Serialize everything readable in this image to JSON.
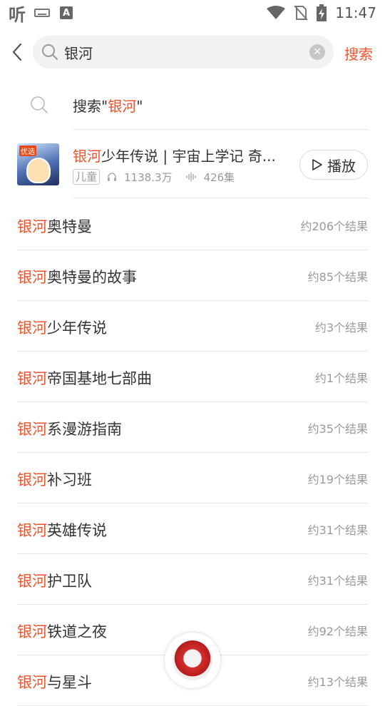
{
  "status_bar": {
    "app_logo": "听",
    "time": "11:47",
    "icons": [
      "keyboard-icon",
      "a-icon",
      "wifi-icon",
      "no-sim-icon",
      "battery-charging-icon"
    ],
    "a_label": "A"
  },
  "search": {
    "query": "银河",
    "placeholder": "",
    "submit_label": "搜索",
    "clear_icon": "✕"
  },
  "suggest": {
    "prefix": "搜索\"",
    "keyword": "银河",
    "suffix": "\""
  },
  "album": {
    "cover_tag": "优选",
    "title_highlight": "银河",
    "title_rest": "少年传说 | 宇宙上学记 奇...",
    "category": "儿童",
    "plays": "1138.3万",
    "episodes": "426集",
    "play_label": "播放"
  },
  "highlight_color": "#f0532c",
  "results": [
    {
      "highlight": "银河",
      "rest": "奥特曼",
      "count": "约206个结果"
    },
    {
      "highlight": "银河",
      "rest": "奥特曼的故事",
      "count": "约85个结果"
    },
    {
      "highlight": "银河",
      "rest": "少年传说",
      "count": "约3个结果"
    },
    {
      "highlight": "银河",
      "rest": "帝国基地七部曲",
      "count": "约1个结果"
    },
    {
      "highlight": "银河",
      "rest": "系漫游指南",
      "count": "约35个结果"
    },
    {
      "highlight": "银河",
      "rest": "补习班",
      "count": "约19个结果"
    },
    {
      "highlight": "银河",
      "rest": "英雄传说",
      "count": "约31个结果"
    },
    {
      "highlight": "银河",
      "rest": "护卫队",
      "count": "约31个结果"
    },
    {
      "highlight": "银河",
      "rest": "铁道之夜",
      "count": "约92个结果"
    },
    {
      "highlight": "银河",
      "rest": "与星斗",
      "count": "约13个结果"
    }
  ]
}
